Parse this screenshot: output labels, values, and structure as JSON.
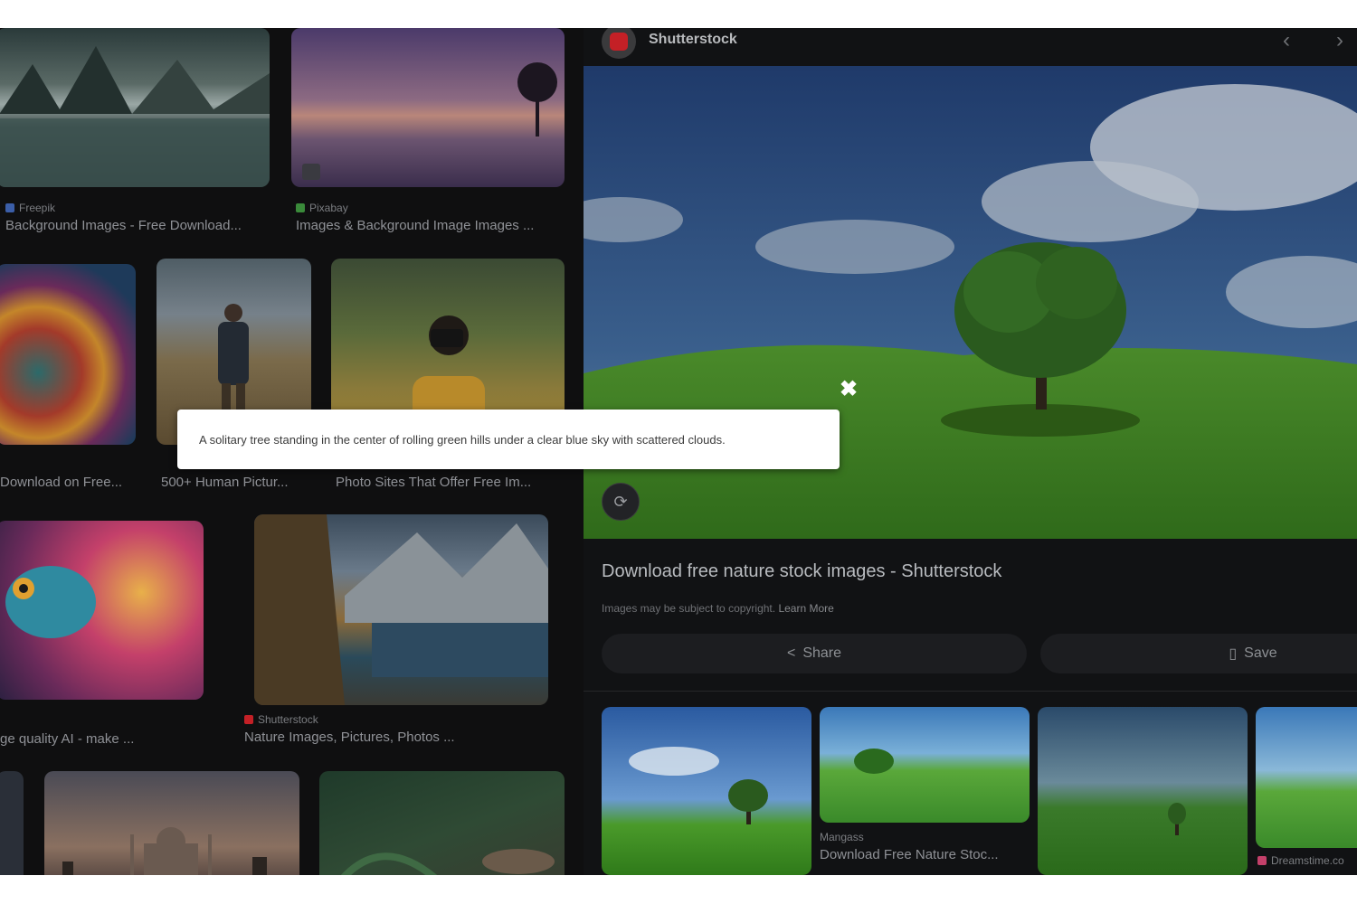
{
  "results": [
    {
      "source": "Freepik",
      "title": "Background Images - Free Download..."
    },
    {
      "source": "Pixabay",
      "title": "Images & Background Image Images ..."
    },
    {
      "source": "",
      "title": "Download on Free..."
    },
    {
      "source": "",
      "title": "500+ Human Pictur..."
    },
    {
      "source": "",
      "title": "Photo Sites That Offer Free Im..."
    },
    {
      "source": "",
      "title": "ge quality AI - make ..."
    },
    {
      "source": "Shutterstock",
      "title": "Nature Images, Pictures, Photos ..."
    }
  ],
  "panel": {
    "site_name": "Shutterstock",
    "prev_icon": "‹",
    "next_icon": "›",
    "title": "Download free nature stock images - Shutterstock",
    "copyright_text": "Images may be subject to copyright.",
    "learn_more": "Learn More",
    "share_label": "Share",
    "save_label": "Save",
    "related": [
      {
        "source": "",
        "title": ""
      },
      {
        "source": "Mangass",
        "title": "Download Free Nature Stoc..."
      },
      {
        "source": "",
        "title": ""
      },
      {
        "source": "Dreamstime.co",
        "title": ""
      }
    ]
  },
  "tooltip": {
    "text": "A solitary tree standing in the center of rolling green hills under a clear blue sky with scattered clouds."
  },
  "icons": {
    "close": "✖",
    "lens": "⟳",
    "share": "<",
    "save": "▯"
  },
  "colors": {
    "accent_red": "#c42026",
    "overlay_bg": "#0f0f10",
    "tooltip_bg": "#ffffff"
  }
}
